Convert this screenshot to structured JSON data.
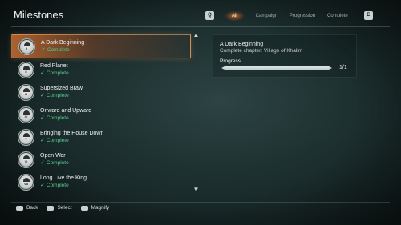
{
  "header": {
    "title": "Milestones",
    "tabs": [
      {
        "label": "All",
        "active": true
      },
      {
        "label": "Campaign",
        "active": false
      },
      {
        "label": "Progression",
        "active": false
      },
      {
        "label": "Complete",
        "active": false
      }
    ],
    "prev_key": "Q",
    "next_key": "E"
  },
  "milestones": [
    {
      "name": "A Dark Beginning",
      "status": "Complete",
      "numeral": "I",
      "selected": true
    },
    {
      "name": "Red Planet",
      "status": "Complete",
      "numeral": "II",
      "selected": false
    },
    {
      "name": "Supersized Brawl",
      "status": "Complete",
      "numeral": "III",
      "selected": false
    },
    {
      "name": "Onward and Upward",
      "status": "Complete",
      "numeral": "IV",
      "selected": false
    },
    {
      "name": "Bringing the House Down",
      "status": "Complete",
      "numeral": "V",
      "selected": false
    },
    {
      "name": "Open War",
      "status": "Complete",
      "numeral": "VI",
      "selected": false
    },
    {
      "name": "Long Live the King",
      "status": "Complete",
      "numeral": "VII",
      "selected": false
    }
  ],
  "detail": {
    "name": "A Dark Beginning",
    "description": "Complete chapter: Village of Khalim",
    "progress_label": "Progress",
    "progress_count": "1/1",
    "progress_fraction": 1.0
  },
  "footer": {
    "back": "Back",
    "select": "Select",
    "magnify": "Magnify"
  },
  "colors": {
    "accent_orange": "#c86e32",
    "complete_green": "#58c98d",
    "background": "#1d2f2f"
  }
}
